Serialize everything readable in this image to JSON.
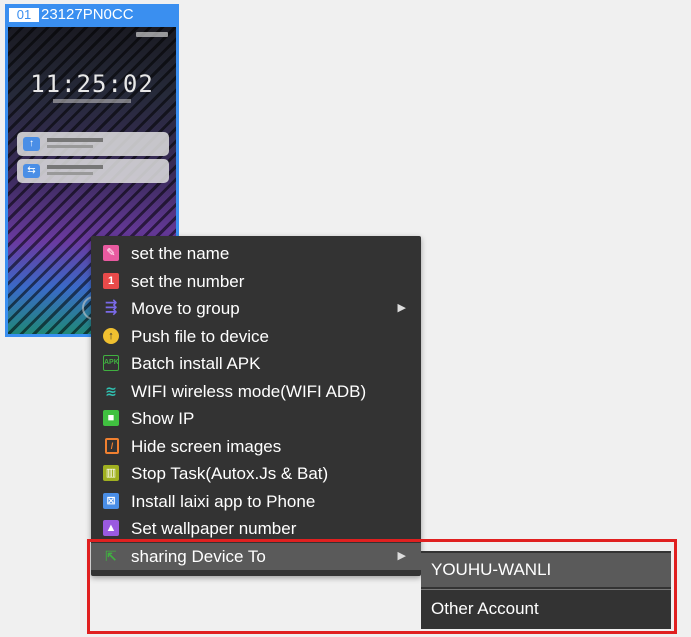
{
  "device": {
    "number": "01",
    "id": "23127PN0CC",
    "screen": {
      "clock": "11:25:02"
    }
  },
  "context_menu": {
    "items": [
      {
        "label": "set the name",
        "icon": "rename-icon",
        "color": "#e85aa0"
      },
      {
        "label": "set the number",
        "icon": "number-icon",
        "color": "#e84a4a"
      },
      {
        "label": "Move to group",
        "icon": "move-group-icon",
        "color": "#7a6ae8",
        "has_submenu": true
      },
      {
        "label": "Push file to device",
        "icon": "push-file-icon",
        "color": "#f0c030"
      },
      {
        "label": "Batch install APK",
        "icon": "apk-icon",
        "color": "#40b040"
      },
      {
        "label": "WIFI wireless mode(WIFI ADB)",
        "icon": "wifi-icon",
        "color": "#30c0b0"
      },
      {
        "label": "Show IP",
        "icon": "bookmark-icon",
        "color": "#40c040"
      },
      {
        "label": "Hide screen images",
        "icon": "hide-screen-icon",
        "color": "#f08030"
      },
      {
        "label": "Stop Task(Autox.Js & Bat)",
        "icon": "trash-icon",
        "color": "#a0b020"
      },
      {
        "label": "Install laixi app to Phone",
        "icon": "install-app-icon",
        "color": "#4a8ee6"
      },
      {
        "label": "Set wallpaper number",
        "icon": "wallpaper-icon",
        "color": "#9a5ae0"
      },
      {
        "label": "sharing Device To",
        "icon": "share-icon",
        "color": "#40b040",
        "has_submenu": true,
        "active": true
      }
    ]
  },
  "submenu": {
    "items": [
      {
        "label": "YOUHU-WANLI",
        "active": true
      },
      {
        "label": "Other Account"
      }
    ]
  },
  "colors": {
    "accent": "#3a8ff0",
    "menu_bg": "#333333",
    "highlight": "#e02020"
  }
}
